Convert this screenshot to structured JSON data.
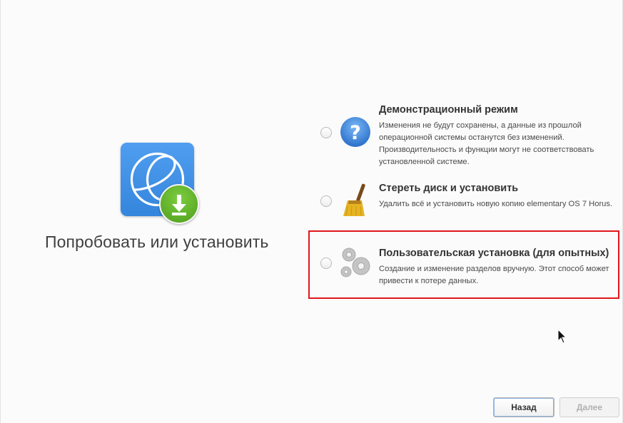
{
  "main": {
    "title": "Попробовать или установить",
    "app_icon": "elementary-os-installer-icon",
    "download_badge_icon": "download-arrow-icon"
  },
  "options": [
    {
      "title": "Демонстрационный режим",
      "description": "Изменения не будут сохранены, а данные из прошлой операционной системы останутся без изменений. Производительность и функции могут не соответствовать установленной системе.",
      "icon": "help-question-icon",
      "selected": false
    },
    {
      "title": "Стереть диск и установить",
      "description": "Удалить всё и установить новую копию elementary OS 7 Horus.",
      "icon": "broom-icon",
      "selected": false
    },
    {
      "title": "Пользовательская установка (для опытных)",
      "description": "Создание и изменение разделов вручную. Этот способ может привести к потере данных.",
      "icon": "gears-icon",
      "selected": false
    }
  ],
  "footer": {
    "back_label": "Назад",
    "next_label": "Далее",
    "next_enabled": false
  },
  "colors": {
    "accent_blue": "#3585dd",
    "badge_green": "#4f9e1e",
    "highlight_red": "#e0181b"
  }
}
